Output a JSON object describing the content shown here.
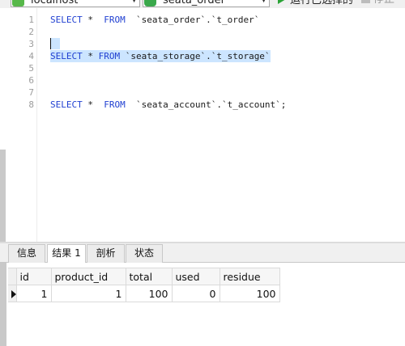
{
  "toolbar": {
    "connection": "localhost",
    "database": "seata_order",
    "run_selected": "运行已选择的",
    "stop": "停止"
  },
  "editor": {
    "lines": [
      {
        "num": "1",
        "kw1": "SELECT",
        "mid": " *  ",
        "kw2": "FROM",
        "rest": "  `seata_order`.`t_order`"
      },
      {
        "num": "2"
      },
      {
        "num": "3"
      },
      {
        "num": "4",
        "kw1": "SELECT",
        "mid": " * ",
        "kw2": "FROM",
        "rest": " `seata_storage`.`t_storage`"
      },
      {
        "num": "5"
      },
      {
        "num": "6"
      },
      {
        "num": "7"
      },
      {
        "num": "8",
        "kw1": "SELECT",
        "mid": " *  ",
        "kw2": "FROM",
        "rest": "  `seata_account`.`t_account`;"
      }
    ]
  },
  "tabs": [
    "信息",
    "结果 1",
    "剖析",
    "状态"
  ],
  "result": {
    "columns": [
      "id",
      "product_id",
      "total",
      "used",
      "residue"
    ],
    "rows": [
      [
        "1",
        "1",
        "100",
        "0",
        "100"
      ]
    ]
  }
}
